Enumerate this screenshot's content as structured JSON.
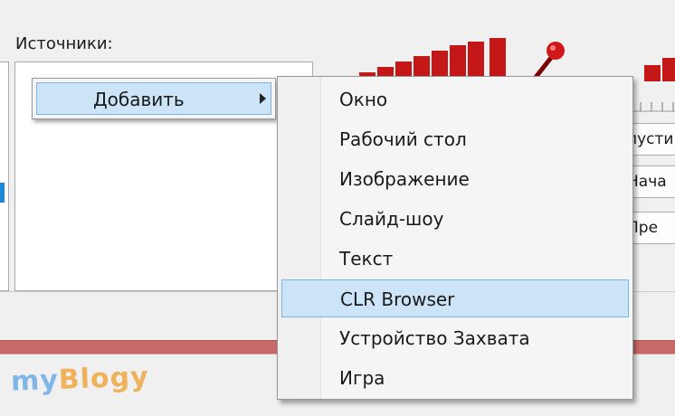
{
  "panel": {
    "sources_label": "Источники:"
  },
  "right_buttons": [
    "пусти",
    "Нача",
    "Пре"
  ],
  "menu": {
    "add_label": "Добавить",
    "submenu": [
      {
        "label": "Окно",
        "highlighted": false
      },
      {
        "label": "Рабочий стол",
        "highlighted": false
      },
      {
        "label": "Изображение",
        "highlighted": false
      },
      {
        "label": "Слайд-шоу",
        "highlighted": false
      },
      {
        "label": "Текст",
        "highlighted": false
      },
      {
        "label": "CLR Browser",
        "highlighted": true
      },
      {
        "label": "Устройство Захвата",
        "highlighted": false
      },
      {
        "label": "Игра",
        "highlighted": false
      }
    ]
  },
  "watermark": {
    "part1": "my",
    "part2": "Blogy"
  },
  "colors": {
    "highlight": "#cce4f7",
    "meter": "#c41818",
    "band": "#c96a6a"
  },
  "icons": {
    "mic": "microphone-icon",
    "submenu_arrow": "chevron-right-icon"
  }
}
